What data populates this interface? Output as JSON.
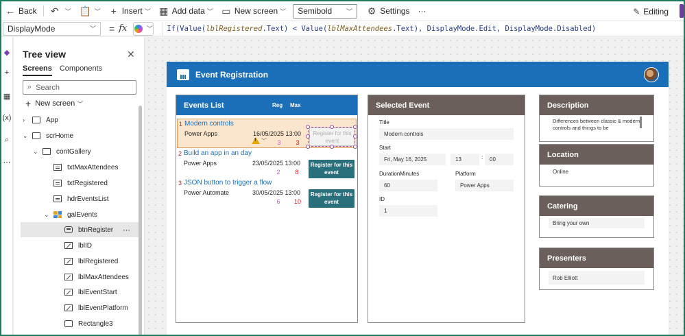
{
  "toolbar": {
    "back": "Back",
    "insert": "Insert",
    "add_data": "Add data",
    "new_screen": "New screen",
    "font_weight": "Semibold",
    "settings": "Settings",
    "more": "···",
    "editing": "Editing"
  },
  "formula_bar": {
    "property": "DisplayMode",
    "equals": "=",
    "fx": "fx",
    "parts": {
      "p1": "If(Value(",
      "p2": "lblRegistered",
      "p3": ".Text) < Value(",
      "p4": "lblMaxAttendees",
      "p5": ".Text), ",
      "p6": "DisplayMode.Edit, DisplayMode.Disabled)"
    }
  },
  "tree": {
    "title": "Tree view",
    "tabs": [
      "Screens",
      "Components"
    ],
    "search_placeholder": "Search",
    "new_screen": "New screen",
    "items": [
      {
        "label": "App",
        "icon": "app-icon"
      },
      {
        "label": "scrHome",
        "icon": "screen-icon"
      },
      {
        "label": "contGallery",
        "icon": "container-icon"
      },
      {
        "label": "txtMaxAttendees",
        "icon": "label-icon"
      },
      {
        "label": "txtRegistered",
        "icon": "label-icon"
      },
      {
        "label": "hdrEventsList",
        "icon": "label-icon"
      },
      {
        "label": "galEvents",
        "icon": "gallery-icon"
      },
      {
        "label": "btnRegister",
        "icon": "button-icon"
      },
      {
        "label": "lblID",
        "icon": "edit-label-icon"
      },
      {
        "label": "lblRegistered",
        "icon": "edit-label-icon"
      },
      {
        "label": "lblMaxAttendees",
        "icon": "edit-label-icon"
      },
      {
        "label": "lblEventStart",
        "icon": "edit-label-icon"
      },
      {
        "label": "lblEventPlatform",
        "icon": "edit-label-icon"
      },
      {
        "label": "Rectangle3",
        "icon": "rectangle-icon"
      }
    ]
  },
  "app": {
    "header_title": "Event Registration",
    "events_list": {
      "title": "Events List",
      "col_reg": "Reg",
      "col_max": "Max",
      "rows": [
        {
          "num": "1",
          "title": "Modern controls",
          "platform": "Power Apps",
          "date": "16/05/2025 13:00",
          "reg": "3",
          "max": "3",
          "button": "Register for this event",
          "enabled": false
        },
        {
          "num": "2",
          "title": "Build an app in an day",
          "platform": "Power Apps",
          "date": "23/05/2025 13:00",
          "reg": "2",
          "max": "8",
          "button": "Register for this event",
          "enabled": true
        },
        {
          "num": "3",
          "title": "JSON button to trigger a flow",
          "platform": "Power Automate",
          "date": "30/05/2025 13:00",
          "reg": "6",
          "max": "10",
          "button": "Register for this event",
          "enabled": true
        }
      ]
    },
    "selected_event": {
      "title": "Selected Event",
      "title_label": "Title",
      "title_value": "Modern controls",
      "start_label": "Start",
      "start_date": "Fri, May 16, 2025",
      "start_hour": "13",
      "time_sep": ":",
      "start_minute": "00",
      "duration_label": "DurationMinutes",
      "duration_value": "60",
      "platform_label": "Platform",
      "platform_value": "Power Apps",
      "id_label": "ID",
      "id_value": "1"
    },
    "description": {
      "title": "Description",
      "value": "Differences between classic & modern controls and things to be"
    },
    "location": {
      "title": "Location",
      "value": "Online"
    },
    "catering": {
      "title": "Catering",
      "value": "Bring your own"
    },
    "presenters": {
      "title": "Presenters",
      "value": "Rob Elliott"
    }
  },
  "colors": {
    "accent": "#1b6fb9",
    "panel_header": "#6b5f5c",
    "button": "#2a6f7c",
    "frame": "#1d7a5f"
  }
}
